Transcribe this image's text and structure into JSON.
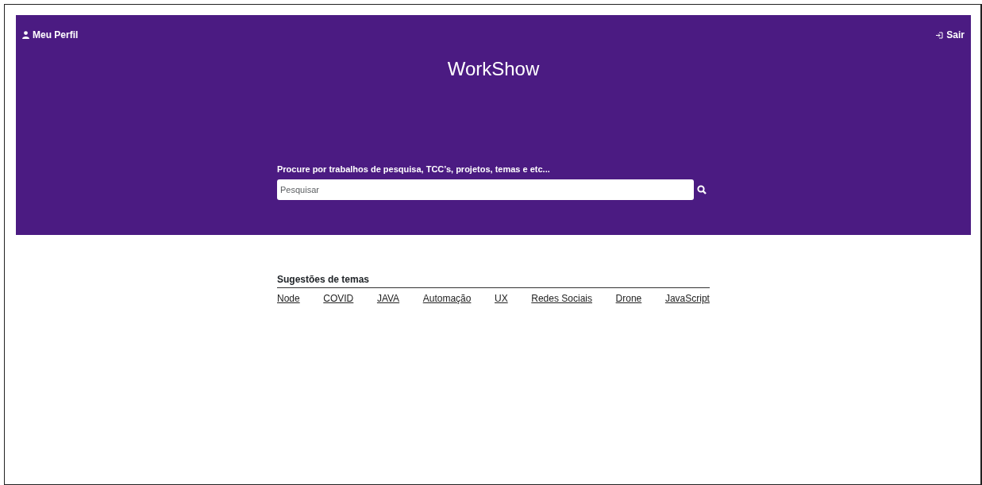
{
  "header": {
    "profile_link": "Meu Perfil",
    "logout_link": "Sair",
    "title": "WorkShow"
  },
  "search": {
    "label": "Procure por trabalhos de pesquisa, TCC’s, projetos, temas e etc...",
    "placeholder": "Pesquisar"
  },
  "suggestions": {
    "heading": "Sugestões de temas",
    "topics": [
      "Node",
      "COVID",
      "JAVA",
      "Automação",
      "UX",
      "Redes Sociais",
      "Drone",
      "JavaScript"
    ]
  }
}
